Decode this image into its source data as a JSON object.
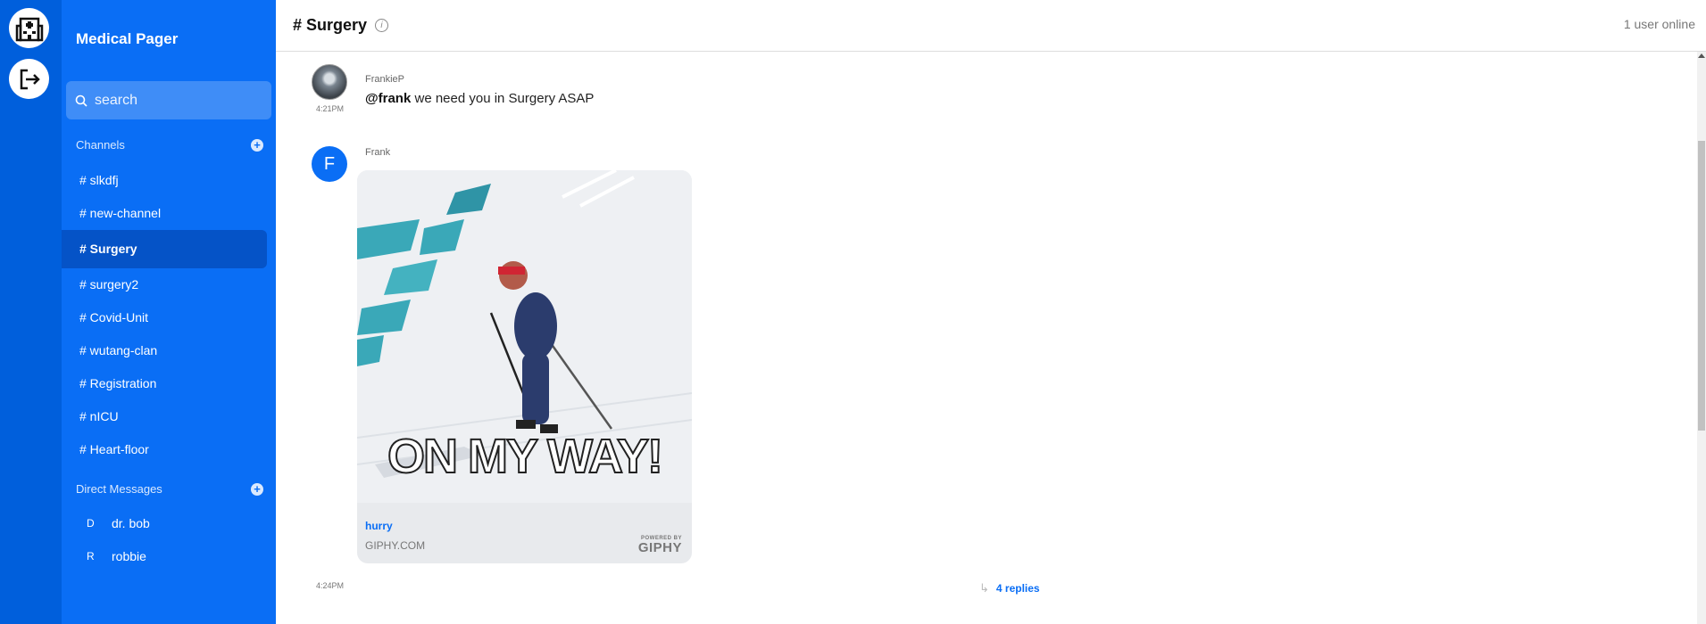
{
  "rail": {
    "top_icon": "hospital-icon",
    "bottom_icon": "logout-icon"
  },
  "sidebar": {
    "team_name": "Medical Pager",
    "search_placeholder": "search",
    "channels_label": "Channels",
    "channels": [
      {
        "label": "# slkdfj"
      },
      {
        "label": "# new-channel"
      },
      {
        "label": "# Surgery",
        "active": true
      },
      {
        "label": "# surgery2"
      },
      {
        "label": "# Covid-Unit"
      },
      {
        "label": "# wutang-clan"
      },
      {
        "label": "# Registration"
      },
      {
        "label": "# nICU"
      },
      {
        "label": "# Heart-floor"
      }
    ],
    "dm_label": "Direct Messages",
    "dms": [
      {
        "initial": "D",
        "name": "dr. bob"
      },
      {
        "initial": "R",
        "name": "robbie"
      }
    ]
  },
  "header": {
    "title": "# Surgery",
    "info_icon": "info-icon",
    "online": "1 user online"
  },
  "messages": [
    {
      "user": "FrankieP",
      "time": "4:21PM",
      "mention": "@frank",
      "text": " we need you in Surgery ASAP"
    },
    {
      "user": "Frank",
      "avatar_initial": "F",
      "time": "4:24PM",
      "attachment": {
        "caption": "ON MY WAY!",
        "title": "hurry",
        "source": "GIPHY.COM",
        "powered_by": "POWERED BY",
        "brand": "GIPHY"
      },
      "replies": "4 replies"
    }
  ],
  "colors": {
    "rail": "#005fdc",
    "sidebar": "#0a6ef5",
    "active_channel": "#0553c7",
    "accent": "#0a6ef5"
  }
}
